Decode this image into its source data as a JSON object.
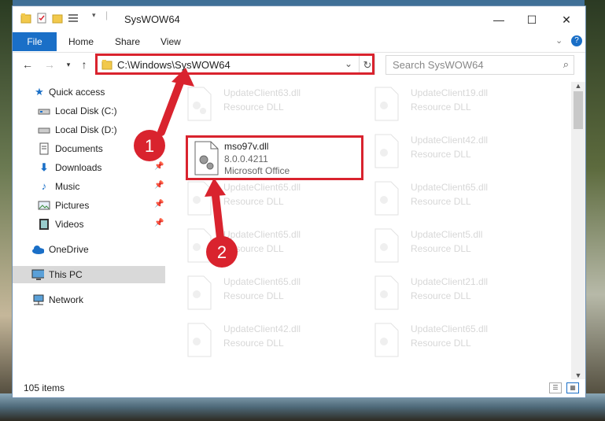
{
  "window": {
    "title": "SysWOW64",
    "controls": {
      "minimize": "—",
      "maximize": "☐",
      "close": "✕"
    }
  },
  "ribbon": {
    "tabs": [
      "File",
      "Home",
      "Share",
      "View"
    ],
    "expand_icon": "chevron-down-icon",
    "help_icon": "help-icon"
  },
  "navigation": {
    "address": "C:\\Windows\\SysWOW64",
    "search_placeholder": "Search SysWOW64"
  },
  "sidebar": {
    "items": [
      {
        "label": "Quick access",
        "icon": "star-icon",
        "pinned": false
      },
      {
        "label": "Local Disk (C:)",
        "icon": "drive-icon",
        "pinned": false
      },
      {
        "label": "Local Disk (D:)",
        "icon": "drive-icon",
        "pinned": false
      },
      {
        "label": "Documents",
        "icon": "documents-icon",
        "pinned": false
      },
      {
        "label": "Downloads",
        "icon": "download-icon",
        "pinned": true
      },
      {
        "label": "Music",
        "icon": "music-icon",
        "pinned": true
      },
      {
        "label": "Pictures",
        "icon": "pictures-icon",
        "pinned": true
      },
      {
        "label": "Videos",
        "icon": "videos-icon",
        "pinned": true
      },
      {
        "label": "OneDrive",
        "icon": "onedrive-icon",
        "pinned": false
      },
      {
        "label": "This PC",
        "icon": "pc-icon",
        "pinned": false,
        "selected": true
      },
      {
        "label": "Network",
        "icon": "network-icon",
        "pinned": false
      }
    ]
  },
  "files": {
    "left_column": [
      {
        "name": "UpdateClient63.dll",
        "desc": "Resource DLL"
      },
      {
        "name": "mso97v.dll",
        "desc": "8.0.0.4211",
        "company": "Microsoft Office",
        "highlighted": true
      },
      {
        "name": "UpdateClient65.dll",
        "desc": "Resource DLL"
      },
      {
        "name": "UpdateClient65.dll",
        "desc": "Resource DLL"
      },
      {
        "name": "UpdateClient65.dll",
        "desc": "Resource DLL"
      },
      {
        "name": "UpdateClient42.dll",
        "desc": "Resource DLL"
      }
    ],
    "right_column": [
      {
        "name": "UpdateClient19.dll",
        "desc": "Resource DLL"
      },
      {
        "name": "UpdateClient42.dll",
        "desc": "Resource DLL"
      },
      {
        "name": "UpdateClient65.dll",
        "desc": "Resource DLL"
      },
      {
        "name": "UpdateClient5.dll",
        "desc": "Resource DLL"
      },
      {
        "name": "UpdateClient21.dll",
        "desc": "Resource DLL"
      },
      {
        "name": "UpdateClient65.dll",
        "desc": "Resource DLL"
      }
    ]
  },
  "status": {
    "item_count": "105 items"
  },
  "annotations": {
    "step1": "1",
    "step2": "2",
    "color": "#d9232e"
  }
}
